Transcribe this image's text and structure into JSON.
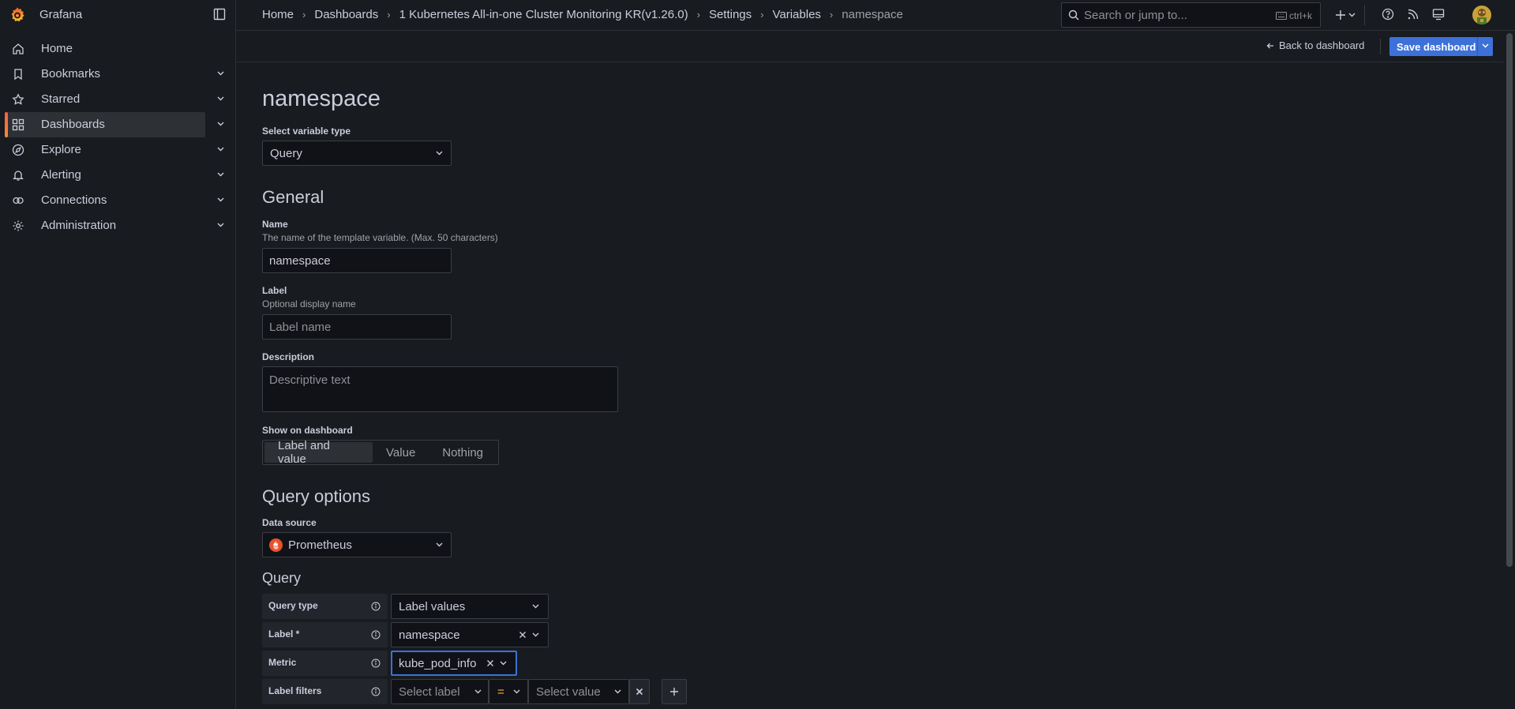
{
  "brand": {
    "name": "Grafana"
  },
  "sidebar": {
    "items": [
      {
        "label": "Home",
        "icon": "home-icon",
        "has_chevron": false
      },
      {
        "label": "Bookmarks",
        "icon": "bookmark-icon",
        "has_chevron": true
      },
      {
        "label": "Starred",
        "icon": "star-icon",
        "has_chevron": true
      },
      {
        "label": "Dashboards",
        "icon": "apps-icon",
        "has_chevron": true,
        "active": true
      },
      {
        "label": "Explore",
        "icon": "compass-icon",
        "has_chevron": true
      },
      {
        "label": "Alerting",
        "icon": "bell-icon",
        "has_chevron": true
      },
      {
        "label": "Connections",
        "icon": "link-icon",
        "has_chevron": true
      },
      {
        "label": "Administration",
        "icon": "cog-icon",
        "has_chevron": true
      }
    ]
  },
  "breadcrumb": [
    "Home",
    "Dashboards",
    "1 Kubernetes All-in-one Cluster Monitoring KR(v1.26.0)",
    "Settings",
    "Variables",
    "namespace"
  ],
  "search": {
    "placeholder": "Search or jump to...",
    "shortcut": "ctrl+k"
  },
  "toolbar": {
    "back_label": "Back to dashboard",
    "save_label": "Save dashboard"
  },
  "form": {
    "title": "namespace",
    "variable_type_label": "Select variable type",
    "variable_type_value": "Query",
    "general_heading": "General",
    "name_label": "Name",
    "name_desc": "The name of the template variable. (Max. 50 characters)",
    "name_value": "namespace",
    "label_label": "Label",
    "label_desc": "Optional display name",
    "label_placeholder": "Label name",
    "description_label": "Description",
    "description_placeholder": "Descriptive text",
    "show_label": "Show on dashboard",
    "show_options": [
      "Label and value",
      "Value",
      "Nothing"
    ],
    "show_selected": "Label and value",
    "query_options_heading": "Query options",
    "datasource_label": "Data source",
    "datasource_value": "Prometheus",
    "query_heading": "Query"
  },
  "query_editor": {
    "query_type_label": "Query type",
    "query_type_value": "Label values",
    "label_row_label": "Label *",
    "label_row_value": "namespace",
    "metric_label": "Metric",
    "metric_value": "kube_pod_info",
    "filters_label": "Label filters",
    "filter_label_placeholder": "Select label",
    "filter_operator": "=",
    "filter_value_placeholder": "Select value"
  },
  "colors": {
    "background": "#181b1f",
    "accent": "#3d71d9",
    "brand_orange": "#f55f3e",
    "operator": "#f5b73d"
  }
}
